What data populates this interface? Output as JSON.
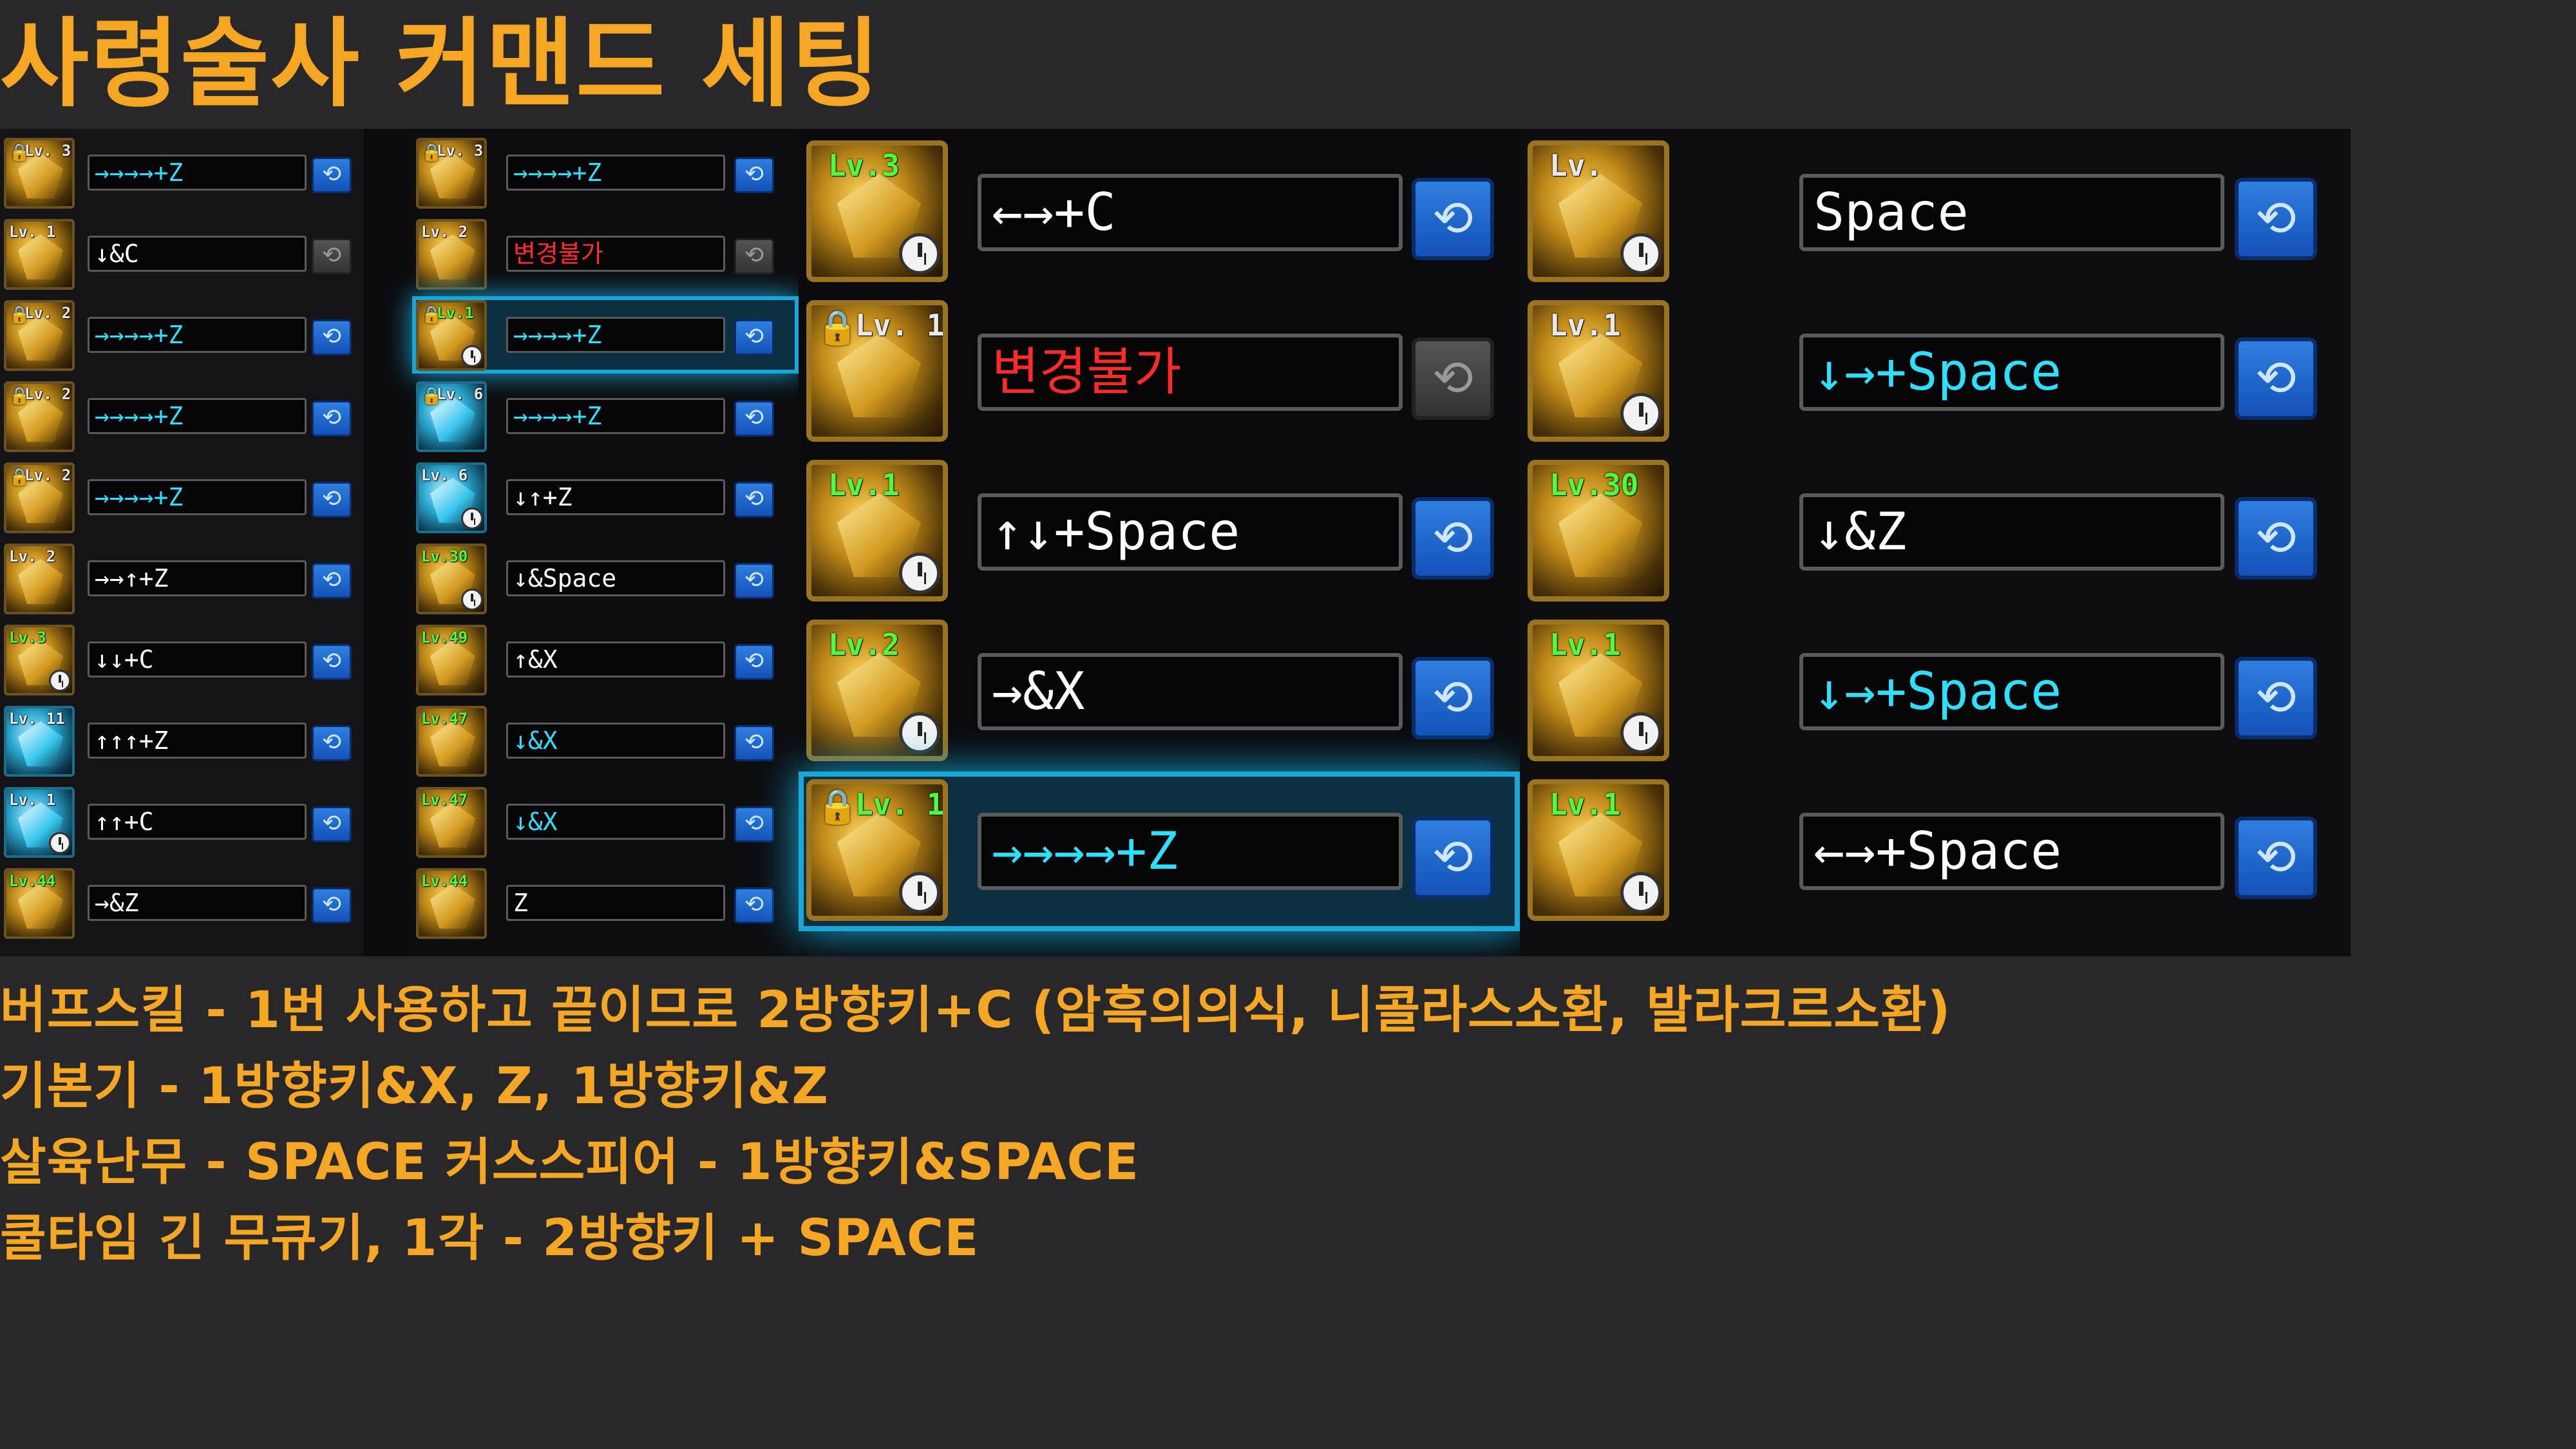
{
  "title": "사령술사 커맨드 세팅",
  "colors": {
    "accent": "#f5a623",
    "cyan_text": "#2ee0ff",
    "red_text": "#ff2a2a",
    "button_blue": "#1f6ad0"
  },
  "icons": {
    "skill": "skill-icon",
    "refresh": "refresh-icon",
    "lock": "lock-icon",
    "clock": "cooldown-clock-icon"
  },
  "refresh_glyph": "⟲",
  "lock_glyph": "🔒",
  "left_list": [
    {
      "level": "Lv. 3",
      "command": "→→→→+Z",
      "style": "cyan",
      "locked": true,
      "disabled": false
    },
    {
      "level": "Lv. 1",
      "command": "↓&C",
      "style": "white",
      "locked": false,
      "disabled": true
    },
    {
      "level": "Lv. 2",
      "command": "→→→→+Z",
      "style": "cyan",
      "locked": true,
      "disabled": false
    },
    {
      "level": "Lv. 2",
      "command": "→→→→+Z",
      "style": "cyan",
      "locked": true,
      "disabled": false
    },
    {
      "level": "Lv. 2",
      "command": "→→→→+Z",
      "style": "cyan",
      "locked": true,
      "disabled": false
    },
    {
      "level": "Lv. 2",
      "command": "→→↑+Z",
      "style": "white",
      "locked": false,
      "disabled": false
    },
    {
      "level": "Lv.3",
      "command": "↓↓+C",
      "style": "white",
      "locked": false,
      "disabled": false,
      "green": true,
      "clock": true
    },
    {
      "level": "Lv. 11",
      "command": "↑↑↑+Z",
      "style": "white",
      "locked": false,
      "disabled": false,
      "cyan_icon": true
    },
    {
      "level": "Lv. 1",
      "command": "↑↑+C",
      "style": "white",
      "locked": false,
      "disabled": false,
      "cyan_icon": true,
      "clock": true
    },
    {
      "level": "Lv.44",
      "command": "→&Z",
      "style": "white",
      "locked": false,
      "disabled": false,
      "green": true
    }
  ],
  "middle_list": [
    {
      "level": "Lv. 3",
      "command": "→→→→+Z",
      "style": "cyan",
      "locked": true,
      "disabled": false
    },
    {
      "level": "Lv. 2",
      "command": "변경불가",
      "style": "red",
      "locked": false,
      "disabled": true
    },
    {
      "level": "Lv.1",
      "command": "→→→→+Z",
      "style": "cyan",
      "locked": true,
      "disabled": false,
      "selected": true,
      "clock": true,
      "green": true
    },
    {
      "level": "Lv. 6",
      "command": "→→→→+Z",
      "style": "cyan",
      "locked": true,
      "disabled": false,
      "cyan_icon": true
    },
    {
      "level": "Lv. 6",
      "command": "↓↑+Z",
      "style": "white",
      "locked": false,
      "disabled": false,
      "cyan_icon": true,
      "clock": true
    },
    {
      "level": "Lv.30",
      "command": "↓&Space",
      "style": "white",
      "locked": false,
      "disabled": false,
      "green": true,
      "clock": true
    },
    {
      "level": "Lv.49",
      "command": "↑&X",
      "style": "white",
      "locked": false,
      "disabled": false,
      "green": true
    },
    {
      "level": "Lv.47",
      "command": "↓&X",
      "style": "cyan",
      "locked": false,
      "disabled": false,
      "green": true
    },
    {
      "level": "Lv.47",
      "command": "↓&X",
      "style": "cyan",
      "locked": false,
      "disabled": false,
      "green": true
    },
    {
      "level": "Lv.44",
      "command": "Z",
      "style": "white",
      "locked": false,
      "disabled": false,
      "green": true
    }
  ],
  "big_left": [
    {
      "level": "Lv.3",
      "command": "←→+C",
      "style": "white",
      "locked": false,
      "disabled": false,
      "green": true,
      "clock": true
    },
    {
      "level": "Lv. 1",
      "command": "변경불가",
      "style": "red",
      "locked": true,
      "disabled": true
    },
    {
      "level": "Lv.1",
      "command": "↑↓+Space",
      "style": "white",
      "locked": false,
      "disabled": false,
      "green": true,
      "clock": true
    },
    {
      "level": "Lv.2",
      "command": "→&X",
      "style": "white",
      "locked": false,
      "disabled": false,
      "green": true,
      "clock": true
    },
    {
      "level": "Lv. 1",
      "command": "→→→→+Z",
      "style": "cyan",
      "locked": true,
      "disabled": false,
      "selected": true,
      "green": true,
      "clock": true
    }
  ],
  "big_right": [
    {
      "level": "Lv.",
      "command": "Space",
      "style": "white",
      "locked": false,
      "disabled": false,
      "clock": true
    },
    {
      "level": "Lv.1",
      "command": "↓→+Space",
      "style": "cyan",
      "locked": false,
      "disabled": false,
      "clock": true
    },
    {
      "level": "Lv.30",
      "command": "↓&Z",
      "style": "white",
      "locked": false,
      "disabled": false,
      "green": true
    },
    {
      "level": "Lv.1",
      "command": "↓→+Space",
      "style": "cyan",
      "locked": false,
      "disabled": false,
      "green": true,
      "clock": true
    },
    {
      "level": "Lv.1",
      "command": "←→+Space",
      "style": "white",
      "locked": false,
      "disabled": false,
      "green": true,
      "clock": true
    }
  ],
  "notes": [
    "버프스킬 - 1번 사용하고 끝이므로 2방향키+C (암흑의의식, 니콜라스소환, 발라크르소환)",
    "기본기 - 1방향키&X, Z, 1방향키&Z",
    "살육난무 - SPACE  커스스피어 - 1방향키&SPACE",
    "쿨타임 긴 무큐기, 1각 - 2방향키 + SPACE"
  ]
}
